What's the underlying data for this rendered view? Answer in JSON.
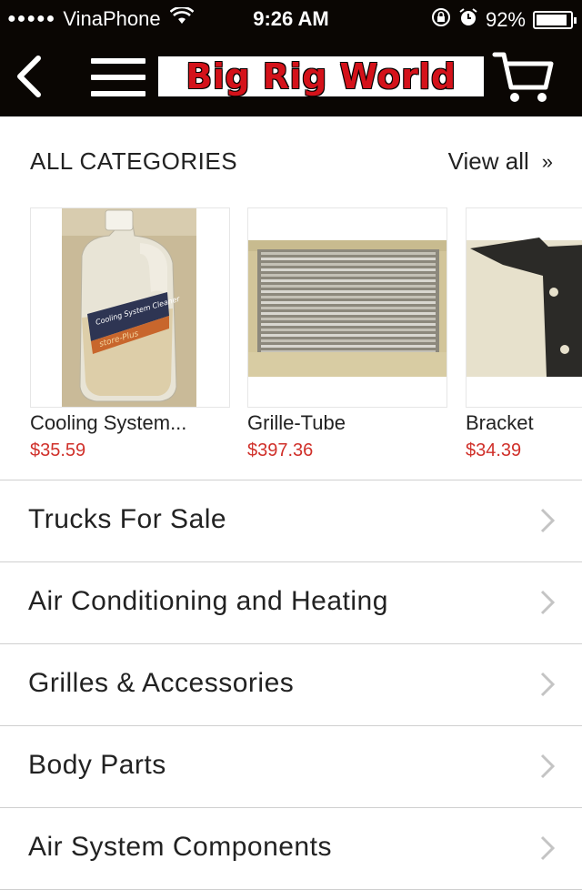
{
  "status_bar": {
    "signal": "●●●●●",
    "carrier": "VinaPhone",
    "time": "9:26 AM",
    "battery": "92%",
    "battery_level": 0.92
  },
  "nav": {
    "logo_text": "Big Rig World"
  },
  "section": {
    "title": "ALL CATEGORIES",
    "view_all": "View all",
    "view_all_chevron": "»"
  },
  "products": [
    {
      "name": "Cooling System...",
      "price": "$35.59",
      "jug_label": "Cooling System Cleaner",
      "jug_band": "store-Plus"
    },
    {
      "name": "Grille-Tube",
      "price": "$397.36"
    },
    {
      "name": "Bracket",
      "price": "$34.39"
    }
  ],
  "categories": [
    {
      "label": "Trucks For Sale"
    },
    {
      "label": "Air Conditioning and Heating"
    },
    {
      "label": "Grilles & Accessories"
    },
    {
      "label": "Body Parts"
    },
    {
      "label": "Air System Components"
    }
  ],
  "colors": {
    "bar_bg": "#0a0603",
    "price": "#d0302a",
    "logo_red": "#d4121a"
  }
}
